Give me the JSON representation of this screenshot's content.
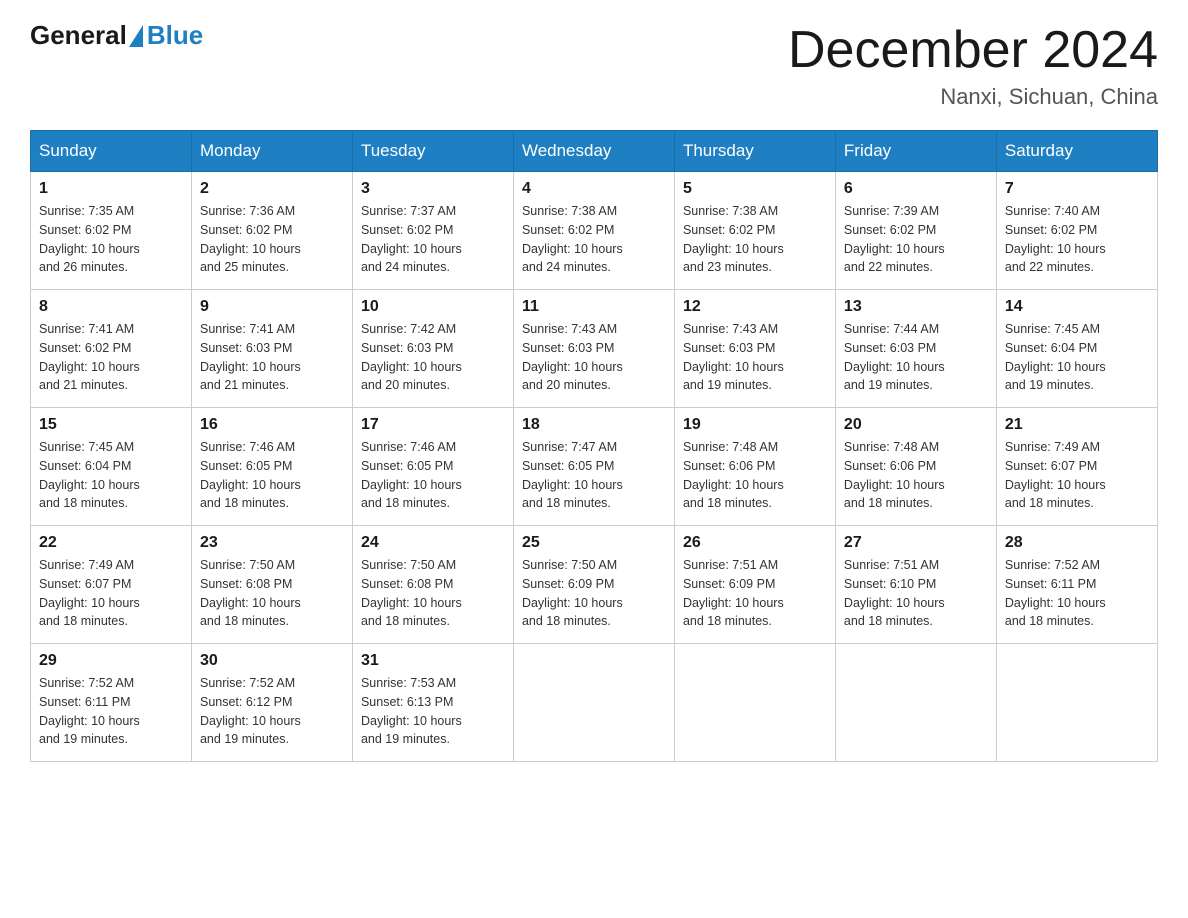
{
  "header": {
    "logo_general": "General",
    "logo_blue": "Blue",
    "month_year": "December 2024",
    "location": "Nanxi, Sichuan, China"
  },
  "weekdays": [
    "Sunday",
    "Monday",
    "Tuesday",
    "Wednesday",
    "Thursday",
    "Friday",
    "Saturday"
  ],
  "weeks": [
    [
      {
        "day": "1",
        "sunrise": "7:35 AM",
        "sunset": "6:02 PM",
        "daylight": "10 hours and 26 minutes."
      },
      {
        "day": "2",
        "sunrise": "7:36 AM",
        "sunset": "6:02 PM",
        "daylight": "10 hours and 25 minutes."
      },
      {
        "day": "3",
        "sunrise": "7:37 AM",
        "sunset": "6:02 PM",
        "daylight": "10 hours and 24 minutes."
      },
      {
        "day": "4",
        "sunrise": "7:38 AM",
        "sunset": "6:02 PM",
        "daylight": "10 hours and 24 minutes."
      },
      {
        "day": "5",
        "sunrise": "7:38 AM",
        "sunset": "6:02 PM",
        "daylight": "10 hours and 23 minutes."
      },
      {
        "day": "6",
        "sunrise": "7:39 AM",
        "sunset": "6:02 PM",
        "daylight": "10 hours and 22 minutes."
      },
      {
        "day": "7",
        "sunrise": "7:40 AM",
        "sunset": "6:02 PM",
        "daylight": "10 hours and 22 minutes."
      }
    ],
    [
      {
        "day": "8",
        "sunrise": "7:41 AM",
        "sunset": "6:02 PM",
        "daylight": "10 hours and 21 minutes."
      },
      {
        "day": "9",
        "sunrise": "7:41 AM",
        "sunset": "6:03 PM",
        "daylight": "10 hours and 21 minutes."
      },
      {
        "day": "10",
        "sunrise": "7:42 AM",
        "sunset": "6:03 PM",
        "daylight": "10 hours and 20 minutes."
      },
      {
        "day": "11",
        "sunrise": "7:43 AM",
        "sunset": "6:03 PM",
        "daylight": "10 hours and 20 minutes."
      },
      {
        "day": "12",
        "sunrise": "7:43 AM",
        "sunset": "6:03 PM",
        "daylight": "10 hours and 19 minutes."
      },
      {
        "day": "13",
        "sunrise": "7:44 AM",
        "sunset": "6:03 PM",
        "daylight": "10 hours and 19 minutes."
      },
      {
        "day": "14",
        "sunrise": "7:45 AM",
        "sunset": "6:04 PM",
        "daylight": "10 hours and 19 minutes."
      }
    ],
    [
      {
        "day": "15",
        "sunrise": "7:45 AM",
        "sunset": "6:04 PM",
        "daylight": "10 hours and 18 minutes."
      },
      {
        "day": "16",
        "sunrise": "7:46 AM",
        "sunset": "6:05 PM",
        "daylight": "10 hours and 18 minutes."
      },
      {
        "day": "17",
        "sunrise": "7:46 AM",
        "sunset": "6:05 PM",
        "daylight": "10 hours and 18 minutes."
      },
      {
        "day": "18",
        "sunrise": "7:47 AM",
        "sunset": "6:05 PM",
        "daylight": "10 hours and 18 minutes."
      },
      {
        "day": "19",
        "sunrise": "7:48 AM",
        "sunset": "6:06 PM",
        "daylight": "10 hours and 18 minutes."
      },
      {
        "day": "20",
        "sunrise": "7:48 AM",
        "sunset": "6:06 PM",
        "daylight": "10 hours and 18 minutes."
      },
      {
        "day": "21",
        "sunrise": "7:49 AM",
        "sunset": "6:07 PM",
        "daylight": "10 hours and 18 minutes."
      }
    ],
    [
      {
        "day": "22",
        "sunrise": "7:49 AM",
        "sunset": "6:07 PM",
        "daylight": "10 hours and 18 minutes."
      },
      {
        "day": "23",
        "sunrise": "7:50 AM",
        "sunset": "6:08 PM",
        "daylight": "10 hours and 18 minutes."
      },
      {
        "day": "24",
        "sunrise": "7:50 AM",
        "sunset": "6:08 PM",
        "daylight": "10 hours and 18 minutes."
      },
      {
        "day": "25",
        "sunrise": "7:50 AM",
        "sunset": "6:09 PM",
        "daylight": "10 hours and 18 minutes."
      },
      {
        "day": "26",
        "sunrise": "7:51 AM",
        "sunset": "6:09 PM",
        "daylight": "10 hours and 18 minutes."
      },
      {
        "day": "27",
        "sunrise": "7:51 AM",
        "sunset": "6:10 PM",
        "daylight": "10 hours and 18 minutes."
      },
      {
        "day": "28",
        "sunrise": "7:52 AM",
        "sunset": "6:11 PM",
        "daylight": "10 hours and 18 minutes."
      }
    ],
    [
      {
        "day": "29",
        "sunrise": "7:52 AM",
        "sunset": "6:11 PM",
        "daylight": "10 hours and 19 minutes."
      },
      {
        "day": "30",
        "sunrise": "7:52 AM",
        "sunset": "6:12 PM",
        "daylight": "10 hours and 19 minutes."
      },
      {
        "day": "31",
        "sunrise": "7:53 AM",
        "sunset": "6:13 PM",
        "daylight": "10 hours and 19 minutes."
      },
      null,
      null,
      null,
      null
    ]
  ],
  "labels": {
    "sunrise": "Sunrise:",
    "sunset": "Sunset:",
    "daylight": "Daylight:"
  }
}
